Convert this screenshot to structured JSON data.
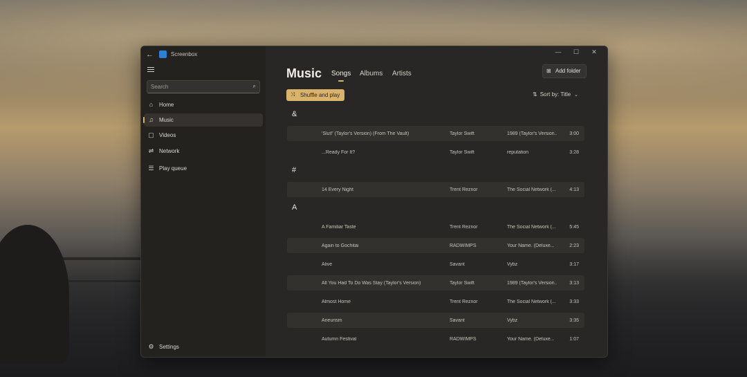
{
  "window": {
    "app_title": "Screenbox"
  },
  "search": {
    "placeholder": "Search"
  },
  "nav": {
    "items": [
      {
        "icon": "home-icon",
        "glyph": "⌂",
        "label": "Home"
      },
      {
        "icon": "music-icon",
        "glyph": "♫",
        "label": "Music"
      },
      {
        "icon": "videos-icon",
        "glyph": "▢",
        "label": "Videos"
      },
      {
        "icon": "network-icon",
        "glyph": "⇌",
        "label": "Network"
      },
      {
        "icon": "play-queue-icon",
        "glyph": "☰",
        "label": "Play queue"
      }
    ],
    "settings": {
      "icon": "settings-icon",
      "glyph": "⚙",
      "label": "Settings"
    }
  },
  "header": {
    "title": "Music",
    "tabs": [
      {
        "label": "Songs"
      },
      {
        "label": "Albums"
      },
      {
        "label": "Artists"
      }
    ],
    "add_folder_label": "Add folder",
    "shuffle_label": "Shuffle and play",
    "sort_label": "Sort by: Title"
  },
  "groups": [
    {
      "letter": "&",
      "rows": [
        {
          "title": "'Slut!' (Taylor's Version) (From The Vault)",
          "artist": "Taylor Swift",
          "album": "1989 (Taylor's Version...",
          "duration": "3:00"
        },
        {
          "title": "...Ready For It?",
          "artist": "Taylor Swift",
          "album": "reputation",
          "duration": "3:28"
        }
      ]
    },
    {
      "letter": "#",
      "rows": [
        {
          "title": "14 Every Night",
          "artist": "Trent Reznor",
          "album": "The Social Network (...",
          "duration": "4:13"
        }
      ]
    },
    {
      "letter": "A",
      "rows": [
        {
          "title": "A Familiar Taste",
          "artist": "Trent Reznor",
          "album": "The Social Network (...",
          "duration": "5:45"
        },
        {
          "title": "Again to Gochitai",
          "artist": "RADWIMPS",
          "album": "Your Name. (Deluxe...",
          "duration": "2:23"
        },
        {
          "title": "Alive",
          "artist": "Savant",
          "album": "Vybz",
          "duration": "3:17"
        },
        {
          "title": "All You Had To Do Was Stay (Taylor's Version)",
          "artist": "Taylor Swift",
          "album": "1989 (Taylor's Version...",
          "duration": "3:13"
        },
        {
          "title": "Almost Home",
          "artist": "Trent Reznor",
          "album": "The Social Network (...",
          "duration": "3:33"
        },
        {
          "title": "Aneurism",
          "artist": "Savant",
          "album": "Vybz",
          "duration": "3:35"
        },
        {
          "title": "Autumn Festival",
          "artist": "RADWIMPS",
          "album": "Your Name. (Deluxe...",
          "duration": "1:07"
        }
      ]
    }
  ]
}
